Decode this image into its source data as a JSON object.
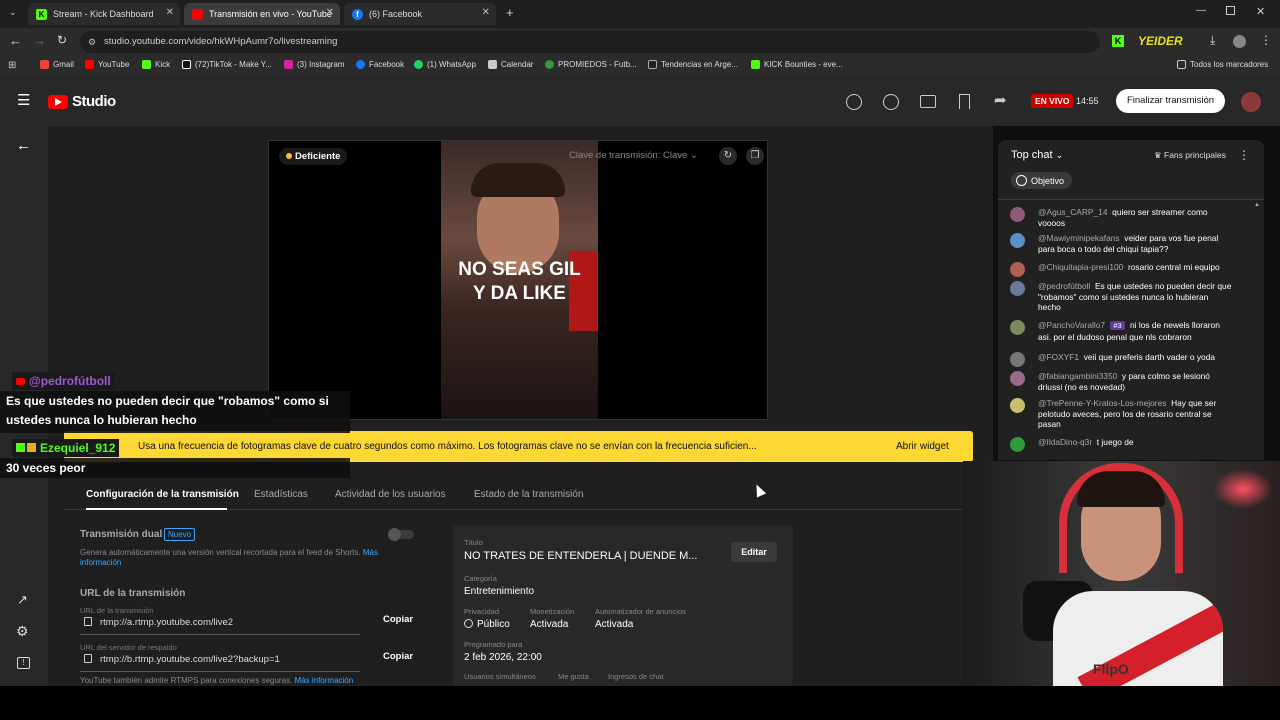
{
  "browser": {
    "tabs": [
      {
        "label": "Stream - Kick Dashboard",
        "active": false
      },
      {
        "label": "Transmisión en vivo - YouTube",
        "active": true
      },
      {
        "label": "(6) Facebook",
        "active": false
      }
    ],
    "url": "studio.youtube.com/video/hkWHpAumr7o/livestreaming",
    "profile": "YEIDER",
    "bookmarks": [
      "Gmail",
      "YouTube",
      "Kick",
      "(72)TikTok - Make Y...",
      "(3) Instagram",
      "Facebook",
      "(1) WhatsApp",
      "Calendar",
      "PROMIEDOS - Futb...",
      "Tendencias en Arge...",
      "KICK Bounties - eve..."
    ],
    "all_bookmarks": "Todos los marcadores"
  },
  "studio": {
    "logo": "Studio",
    "live_badge": "EN VIVO",
    "live_time": "14:55",
    "end_button": "Finalizar transmisión"
  },
  "preview": {
    "quality": "Deficiente",
    "stream_key_label": "Clave de transmisión: Clave",
    "overlay_line1": "NO SEAS GIL",
    "overlay_line2": "Y DA LIKE"
  },
  "warning": {
    "text": "Usa una frecuencia de fotogramas clave de cuatro segundos como máximo. Los fotogramas clave no se envían con la frecuencia suficien...",
    "button": "Abrir widget"
  },
  "tabs": [
    "Configuración de la transmisión",
    "Estadísticas",
    "Actividad de los usuarios",
    "Estado de la transmisión"
  ],
  "settings": {
    "dual_title": "Transmisión dual",
    "dual_badge": "Nuevo",
    "dual_desc": "Genera automáticamente una versión vertical recortada para el feed de Shorts.",
    "dual_more": "Más información",
    "url_section": "URL de la transmisión",
    "url_label": "URL de la transmisión",
    "url_value": "rtmp://a.rtmp.youtube.com/live2",
    "backup_label": "URL del servidor de respaldo",
    "backup_value": "rtmp://b.rtmp.youtube.com/live2?backup=1",
    "copy": "Copiar",
    "rtmps_note": "YouTube también admite RTMPS para conexiones seguras.",
    "rtmps_more": "Más información"
  },
  "details": {
    "title_label": "Título",
    "title_value": "NO TRATES DE ENTENDERLA | DUENDE M...",
    "edit": "Editar",
    "category_label": "Categoría",
    "category_value": "Entretenimiento",
    "privacy_label": "Privacidad",
    "privacy_value": "Público",
    "monet_label": "Monetización",
    "monet_value": "Activada",
    "ads_label": "Automatizador de anuncios",
    "ads_value": "Activada",
    "sched_label": "Programado para",
    "sched_value": "2 feb 2026, 22:00",
    "viewers_label": "Usuarios simultáneos",
    "likes_label": "Me gusta",
    "chat_income_label": "Ingresos de chat"
  },
  "chat": {
    "mode": "Top chat",
    "fans": "Fans principales",
    "goal": "Objetivo",
    "messages": [
      {
        "user": "@Agus_CARP_14",
        "text": "quiero ser streamer como voooos",
        "color": "#8e5a7a"
      },
      {
        "user": "@Mawiyminipekafans",
        "text": "veider para vos fue penal para boca o todo del chiqui tapia??",
        "color": "#5b8fc7"
      },
      {
        "user": "@Chiquitapia-presi100",
        "text": "rosario central mi equipo",
        "color": "#b06050"
      },
      {
        "user": "@pedrofútboll",
        "text": "Es que ustedes no pueden decir que \"robamos\" como si ustedes nunca lo hubieran hecho",
        "color": "#6b7a9a"
      },
      {
        "user": "@PanchoVarallo7",
        "badge": "#3",
        "text": "ni los de newels lloraron asi. por el dudoso penal que nls cobraron",
        "color": "#7a8a5a"
      },
      {
        "user": "@FOXYF1",
        "text": "veii que preferis darth vader o yoda",
        "color": "#777777"
      },
      {
        "user": "@fabiangambini3350",
        "text": "y para colmo se lesionó driussi (no es novedad)",
        "color": "#9a6a8a"
      },
      {
        "user": "@TrePenne-Y-Kratos-Los-mejores",
        "text": "Hay que ser pelotudo aveces, pero los de rosario central se pasan",
        "color": "#c8c070"
      },
      {
        "user": "@IldaDino-q3r",
        "text": "t juego de",
        "color": "#2e9a3a"
      }
    ]
  },
  "overlays": {
    "msg1_user": "@pedrofútboll",
    "msg1_text_line1": "Es que ustedes no pueden decir que \"robamos\" como si",
    "msg1_text_line2": "ustedes nunca lo hubieran hecho",
    "msg2_user": "Ezequiel_912",
    "msg2_text": "30 veces peor"
  },
  "webcam_shirt_text": "FlipO"
}
